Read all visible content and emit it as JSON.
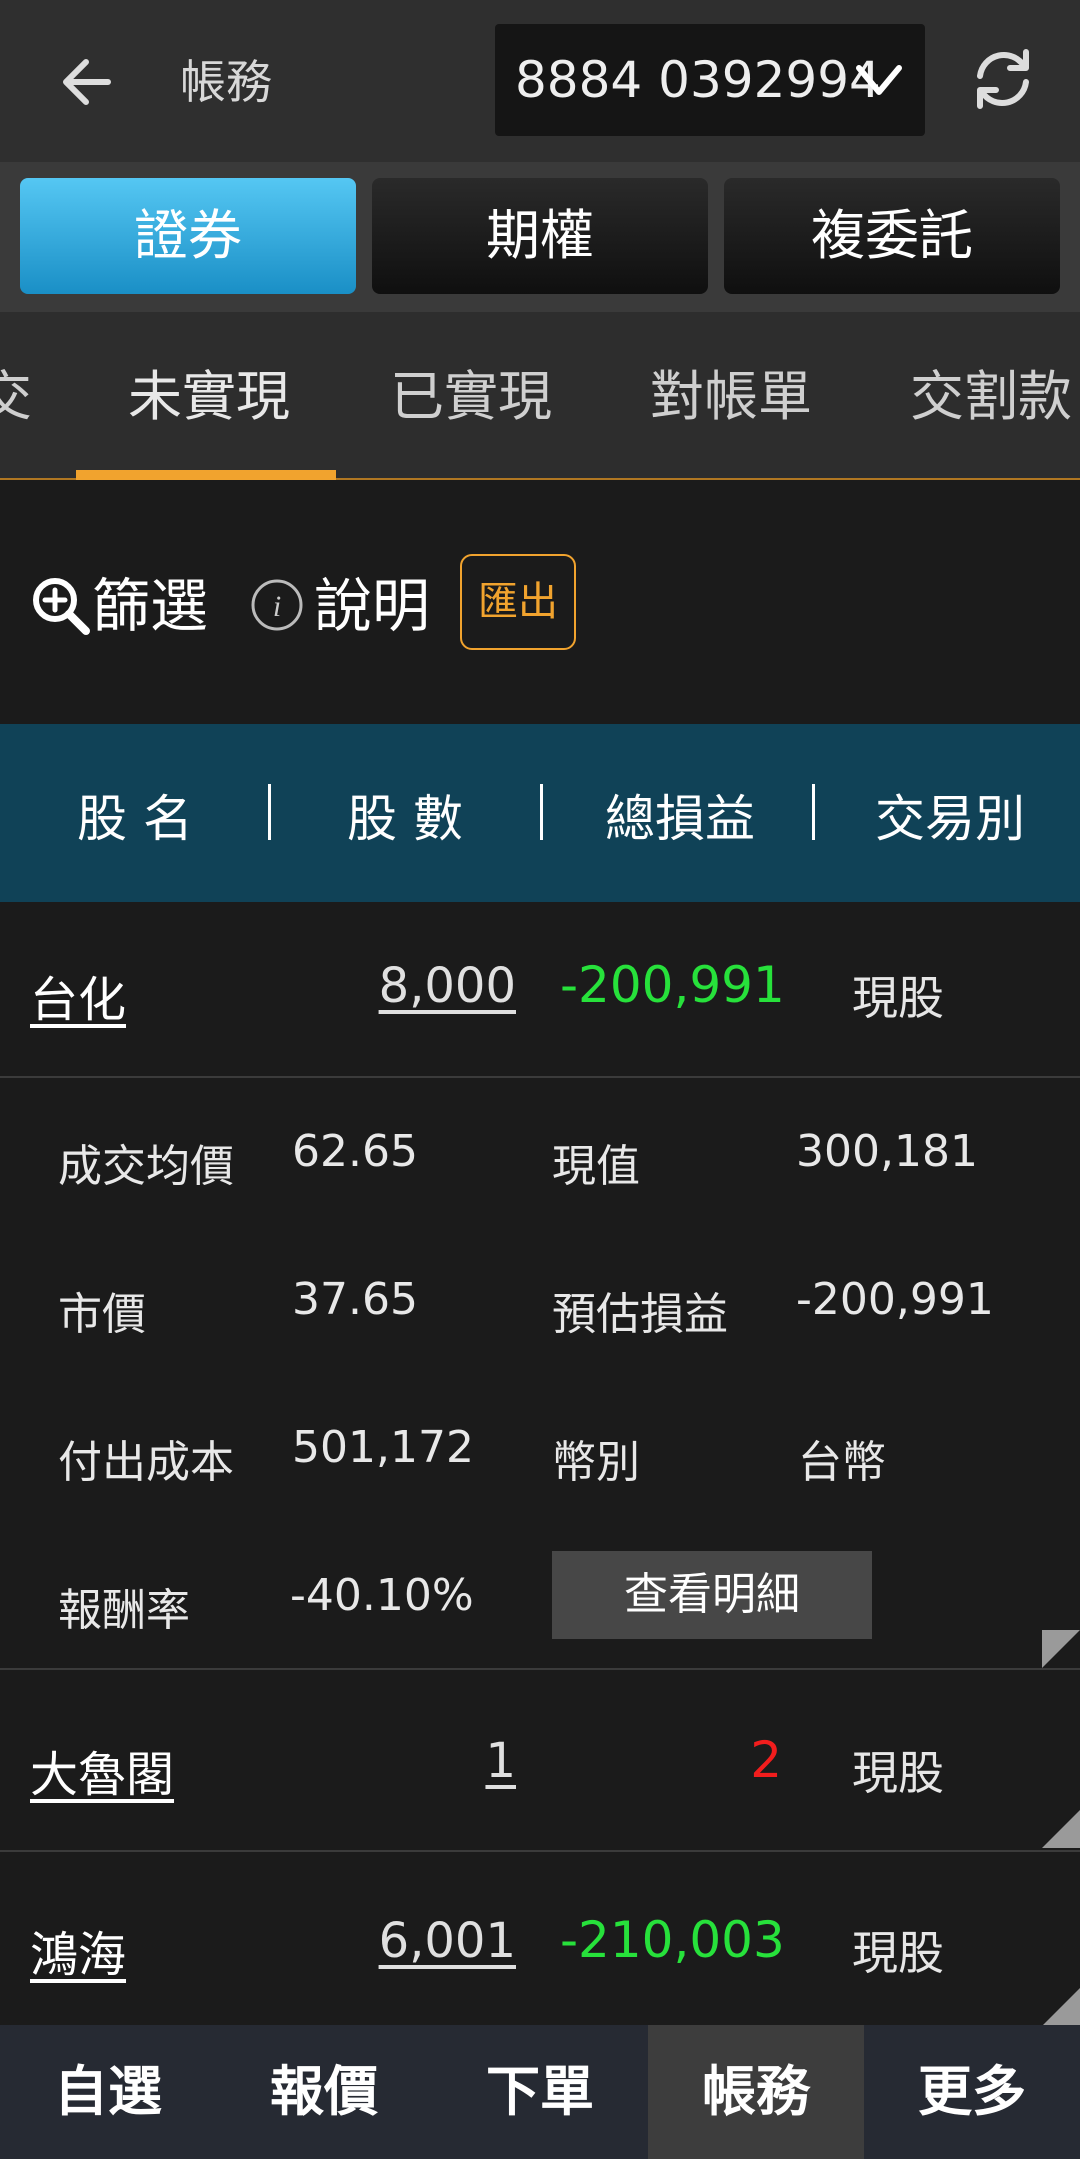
{
  "header": {
    "title": "帳務",
    "account": "8884 0392994"
  },
  "segments": [
    {
      "label": "證券",
      "active": true
    },
    {
      "label": "期權",
      "active": false
    },
    {
      "label": "複委託",
      "active": false
    }
  ],
  "subtabs": [
    "交",
    "未實現",
    "已實現",
    "對帳單",
    "交割款"
  ],
  "toolbar": {
    "filter_label": "篩選",
    "info_label": "說明",
    "export_label": "匯出"
  },
  "columns": [
    "股 名",
    "股 數",
    "總損益",
    "交易別"
  ],
  "rows": [
    {
      "name": "台化",
      "qty": "8,000",
      "pl": "-200,991",
      "type": "現股"
    },
    {
      "name": "大魯閣",
      "qty": "1",
      "pl": "2",
      "type": "現股"
    },
    {
      "name": "鴻海",
      "qty": "6,001",
      "pl": "-210,003",
      "type": "現股"
    }
  ],
  "detail": {
    "avg_price_label": "成交均價",
    "avg_price": "62.65",
    "market_value_label": "現值",
    "market_value": "300,181",
    "price_label": "市價",
    "price": "37.65",
    "est_pl_label": "預估損益",
    "est_pl": "-200,991",
    "cost_label": "付出成本",
    "cost": "501,172",
    "currency_label": "幣別",
    "currency": "台幣",
    "roi_label": "報酬率",
    "roi": "-40.10%",
    "view_detail_label": "查看明細"
  },
  "bottom_nav": [
    {
      "label": "自選",
      "active": false
    },
    {
      "label": "報價",
      "active": false
    },
    {
      "label": "下單",
      "active": false
    },
    {
      "label": "帳務",
      "active": true
    },
    {
      "label": "更多",
      "active": false
    }
  ],
  "colors": {
    "accent": "#f1a32e",
    "gain": "#f21d1d",
    "loss": "#27e13b",
    "tab_active": "#2aa6dc",
    "header_band": "#104257"
  }
}
